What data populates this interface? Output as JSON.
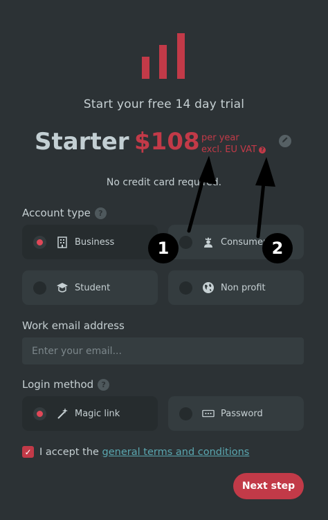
{
  "header": {
    "subtitle": "Start your free 14 day trial"
  },
  "plan": {
    "name": "Starter",
    "price": "$108",
    "period_line1": "per year",
    "period_line2": "excl. EU VAT",
    "edit_icon": "pencil-icon"
  },
  "notice": "No credit card required.",
  "account_type": {
    "label": "Account type",
    "options": [
      {
        "label": "Business",
        "icon": "building-icon",
        "selected": true
      },
      {
        "label": "Consumer",
        "icon": "person-icon",
        "selected": false
      },
      {
        "label": "Student",
        "icon": "graduation-cap-icon",
        "selected": false
      },
      {
        "label": "Non profit",
        "icon": "globe-icon",
        "selected": false
      }
    ]
  },
  "email": {
    "label": "Work email address",
    "placeholder": "Enter your email...",
    "value": ""
  },
  "login_method": {
    "label": "Login method",
    "options": [
      {
        "label": "Magic link",
        "icon": "magic-wand-icon",
        "selected": true
      },
      {
        "label": "Password",
        "icon": "password-field-icon",
        "selected": false
      }
    ]
  },
  "terms": {
    "prefix": "I accept the ",
    "link_text": "general terms and conditions",
    "checked": true
  },
  "next_button": "Next step",
  "annotations": {
    "badge_1": "1",
    "badge_2": "2"
  },
  "colors": {
    "background": "#2c3235",
    "accent": "#c23a48",
    "link": "#5aa7b0"
  }
}
